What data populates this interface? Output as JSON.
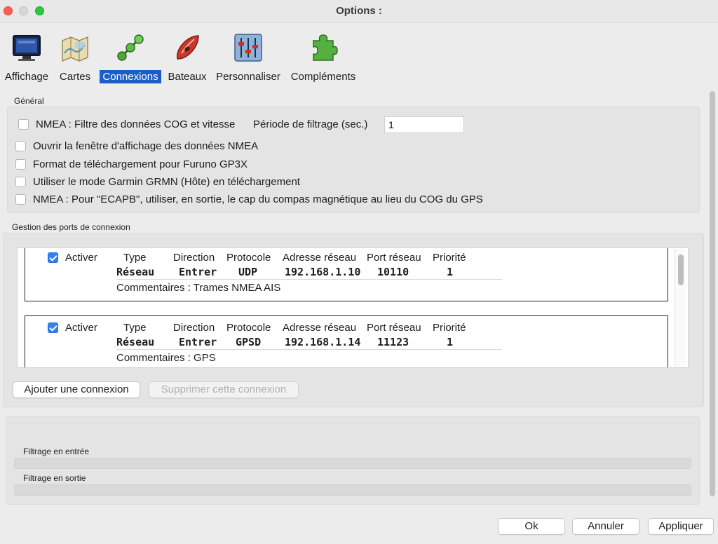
{
  "window": {
    "title": "Options :"
  },
  "toolbar": {
    "items": [
      {
        "label": "Affichage",
        "icon": "monitor-icon"
      },
      {
        "label": "Cartes",
        "icon": "charts-icon"
      },
      {
        "label": "Connexions",
        "icon": "connections-icon",
        "selected": true
      },
      {
        "label": "Bateaux",
        "icon": "boat-icon"
      },
      {
        "label": "Personnaliser",
        "icon": "sliders-icon"
      },
      {
        "label": "Compléments",
        "icon": "puzzle-icon"
      }
    ]
  },
  "general": {
    "title": "Général",
    "nmea_filter_label": "NMEA : Filtre des données COG et vitesse",
    "nmea_filter_checked": false,
    "period_label": "Période de filtrage (sec.)",
    "period_value": "1",
    "open_nmea_window_label": "Ouvrir la fenêtre d'affichage des données NMEA",
    "open_nmea_window_checked": false,
    "furuno_label": "Format de téléchargement pour Furuno GP3X",
    "furuno_checked": false,
    "garmin_label": "Utiliser le mode Garmin GRMN (Hôte) en téléchargement",
    "garmin_checked": false,
    "ecapb_label": "NMEA : Pour \"ECAPB\", utiliser, en sortie, le cap du compas magnétique  au lieu du COG du GPS",
    "ecapb_checked": false
  },
  "ports": {
    "title": "Gestion des ports de connexion",
    "headers": {
      "enable": "Activer",
      "type": "Type",
      "direction": "Direction",
      "protocol": "Protocole",
      "address": "Adresse réseau",
      "port": "Port réseau",
      "priority": "Priorité"
    },
    "connections": [
      {
        "enabled": true,
        "type": "Réseau",
        "direction": "Entrer",
        "protocol": "UDP",
        "address": "192.168.1.10",
        "port": "10110",
        "priority": "1",
        "comment": "Commentaires : Trames NMEA AIS"
      },
      {
        "enabled": true,
        "type": "Réseau",
        "direction": "Entrer",
        "protocol": "GPSD",
        "address": "192.168.1.14",
        "port": "11123",
        "priority": "1",
        "comment": "Commentaires : GPS"
      }
    ],
    "add_button": "Ajouter une connexion",
    "remove_button": "Supprimer cette connexion"
  },
  "filters": {
    "input_label": "Filtrage en entrée",
    "output_label": "Filtrage en sortie"
  },
  "footer": {
    "ok": "Ok",
    "cancel": "Annuler",
    "apply": "Appliquer"
  },
  "colors": {
    "selection": "#1c5ec7",
    "checkbox_on": "#2f7ff6"
  }
}
